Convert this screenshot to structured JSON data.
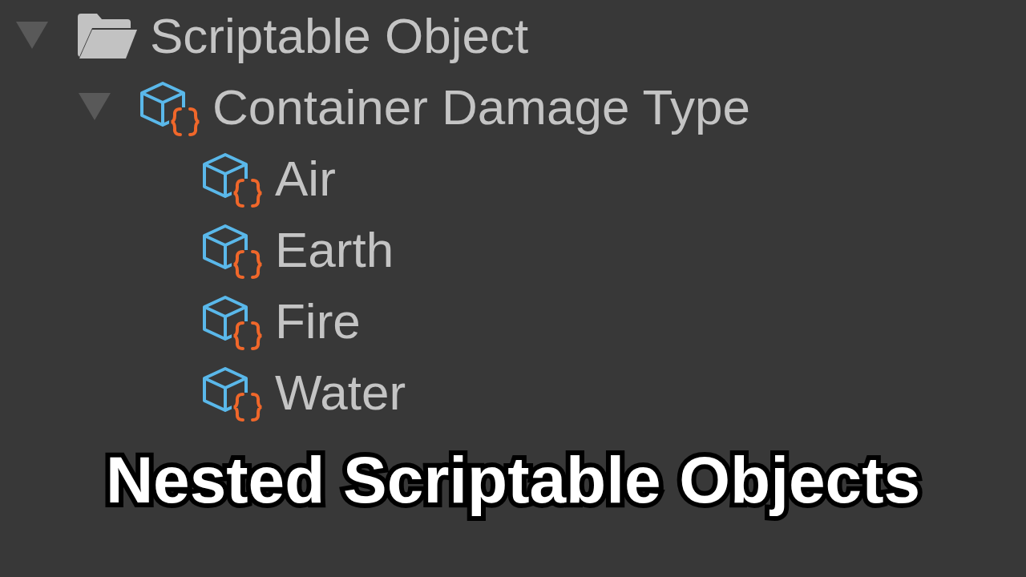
{
  "tree": [
    {
      "kind": "folder",
      "label": "Scriptable Object",
      "expanded": true,
      "children": [
        {
          "kind": "asset",
          "label": "Container Damage Type",
          "expanded": true,
          "children": [
            {
              "kind": "asset",
              "label": "Air"
            },
            {
              "kind": "asset",
              "label": "Earth"
            },
            {
              "kind": "asset",
              "label": "Fire"
            },
            {
              "kind": "asset",
              "label": "Water"
            }
          ]
        }
      ]
    }
  ],
  "caption": "Nested Scriptable Objects"
}
